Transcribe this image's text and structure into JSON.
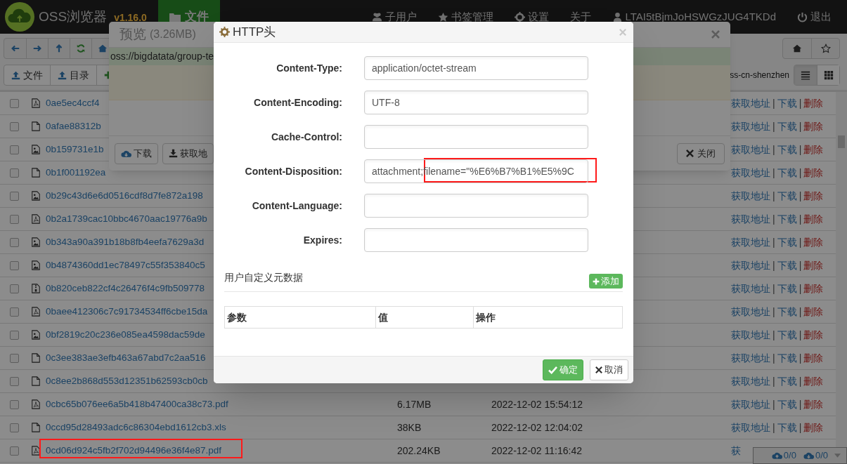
{
  "navbar": {
    "app_name": "OSS浏览器",
    "version": "v1.16.0",
    "tabs": [
      {
        "label": "文件",
        "selected": true
      }
    ],
    "menu": [
      {
        "label": "子用户",
        "kind": "users"
      },
      {
        "label": "书签管理",
        "kind": "star"
      },
      {
        "label": "设置",
        "kind": "gear"
      },
      {
        "label": "关于",
        "kind": "plain"
      },
      {
        "label": "LTAI5tBjmJoHSWGzJUG4TKDd",
        "kind": "user"
      },
      {
        "label": "退出",
        "kind": "power"
      }
    ]
  },
  "toolbar": {
    "upload_buttons": [
      {
        "label": "文件"
      },
      {
        "label": "目录"
      }
    ],
    "region": "ss-cn-shenzhen",
    "view_modes": [
      {
        "kind": "list",
        "selected": true
      },
      {
        "kind": "grid",
        "selected": false
      }
    ]
  },
  "files": [
    {
      "kind": "pdf",
      "name": "0ae5ec4ccf4",
      "checked": false,
      "highlighted": false,
      "actions": [
        {
          "kind": "link",
          "label": "获取地址"
        },
        {
          "kind": "sep",
          "label": "|"
        },
        {
          "kind": "link",
          "label": "下载"
        },
        {
          "kind": "sep",
          "label": "|"
        },
        {
          "kind": "danger",
          "label": "删除"
        }
      ]
    },
    {
      "kind": "file",
      "name": "0afae88312b",
      "checked": false,
      "highlighted": false,
      "actions": [
        {
          "kind": "link",
          "label": "获取地址"
        },
        {
          "kind": "sep",
          "label": "|"
        },
        {
          "kind": "link",
          "label": "下载"
        },
        {
          "kind": "sep",
          "label": "|"
        },
        {
          "kind": "danger",
          "label": "删除"
        }
      ]
    },
    {
      "kind": "image",
      "name": "0b159731e1b",
      "checked": false,
      "highlighted": false,
      "actions": [
        {
          "kind": "link",
          "label": "获取地址"
        },
        {
          "kind": "sep",
          "label": "|"
        },
        {
          "kind": "link",
          "label": "下载"
        },
        {
          "kind": "sep",
          "label": "|"
        },
        {
          "kind": "danger",
          "label": "删除"
        }
      ]
    },
    {
      "kind": "file",
      "name": "0b1f001192ea",
      "checked": false,
      "highlighted": false,
      "actions": [
        {
          "kind": "link",
          "label": "获取地址"
        },
        {
          "kind": "sep",
          "label": "|"
        },
        {
          "kind": "link",
          "label": "下载"
        },
        {
          "kind": "sep",
          "label": "|"
        },
        {
          "kind": "danger",
          "label": "删除"
        }
      ]
    },
    {
      "kind": "image",
      "name": "0b29c43d6e6d0516cdf8d7fe872a198",
      "checked": false,
      "highlighted": false,
      "actions": [
        {
          "kind": "link",
          "label": "获取地址"
        },
        {
          "kind": "sep",
          "label": "|"
        },
        {
          "kind": "link",
          "label": "下载"
        },
        {
          "kind": "sep",
          "label": "|"
        },
        {
          "kind": "danger",
          "label": "删除"
        }
      ]
    },
    {
      "kind": "pdf",
      "name": "0b2a1739cac10bbc4670aac19776a9b",
      "checked": false,
      "highlighted": false,
      "actions": [
        {
          "kind": "link",
          "label": "获取地址"
        },
        {
          "kind": "sep",
          "label": "|"
        },
        {
          "kind": "link",
          "label": "下载"
        },
        {
          "kind": "sep",
          "label": "|"
        },
        {
          "kind": "danger",
          "label": "删除"
        }
      ]
    },
    {
      "kind": "image",
      "name": "0b343a90a391b18b8fb4eefa7629a3d",
      "checked": false,
      "highlighted": false,
      "actions": [
        {
          "kind": "link",
          "label": "获取地址"
        },
        {
          "kind": "sep",
          "label": "|"
        },
        {
          "kind": "link",
          "label": "下载"
        },
        {
          "kind": "sep",
          "label": "|"
        },
        {
          "kind": "danger",
          "label": "删除"
        }
      ]
    },
    {
      "kind": "image",
      "name": "0b4874360dd1ec78497c55f353840c5",
      "checked": false,
      "highlighted": false,
      "actions": [
        {
          "kind": "link",
          "label": "获取地址"
        },
        {
          "kind": "sep",
          "label": "|"
        },
        {
          "kind": "link",
          "label": "下载"
        },
        {
          "kind": "sep",
          "label": "|"
        },
        {
          "kind": "danger",
          "label": "删除"
        }
      ]
    },
    {
      "kind": "archive",
      "name": "0b820ceb822cf4c26476f4c9fb509778",
      "checked": false,
      "highlighted": false,
      "actions": [
        {
          "kind": "link",
          "label": "获取地址"
        },
        {
          "kind": "sep",
          "label": "|"
        },
        {
          "kind": "link",
          "label": "下载"
        },
        {
          "kind": "sep",
          "label": "|"
        },
        {
          "kind": "danger",
          "label": "删除"
        }
      ]
    },
    {
      "kind": "pdf",
      "name": "0baee412306c7c91734534ff6cbe15da",
      "checked": false,
      "highlighted": false,
      "actions": [
        {
          "kind": "link",
          "label": "获取地址"
        },
        {
          "kind": "sep",
          "label": "|"
        },
        {
          "kind": "link",
          "label": "下载"
        },
        {
          "kind": "sep",
          "label": "|"
        },
        {
          "kind": "danger",
          "label": "删除"
        }
      ]
    },
    {
      "kind": "image",
      "name": "0bf2819c20c236e085ea4598dac59de",
      "checked": false,
      "highlighted": false,
      "actions": [
        {
          "kind": "link",
          "label": "获取地址"
        },
        {
          "kind": "sep",
          "label": "|"
        },
        {
          "kind": "link",
          "label": "下载"
        },
        {
          "kind": "sep",
          "label": "|"
        },
        {
          "kind": "danger",
          "label": "删除"
        }
      ]
    },
    {
      "kind": "file",
      "name": "0c3ee383ae3efb463a67abd7c2aa516",
      "checked": false,
      "highlighted": false,
      "actions": [
        {
          "kind": "link",
          "label": "获取地址"
        },
        {
          "kind": "sep",
          "label": "|"
        },
        {
          "kind": "link",
          "label": "下载"
        },
        {
          "kind": "sep",
          "label": "|"
        },
        {
          "kind": "danger",
          "label": "删除"
        }
      ]
    },
    {
      "kind": "file",
      "name": "0c8ee2b868d553d12351b62593cb0cb",
      "checked": false,
      "highlighted": false,
      "actions": [
        {
          "kind": "link",
          "label": "获取地址"
        },
        {
          "kind": "sep",
          "label": "|"
        },
        {
          "kind": "link",
          "label": "下载"
        },
        {
          "kind": "sep",
          "label": "|"
        },
        {
          "kind": "danger",
          "label": "删除"
        }
      ]
    },
    {
      "kind": "pdf",
      "name": "0cbc65b076ee6a5b418b47400ca38c73.pdf",
      "size": "6.17MB",
      "date": "2022-12-02 15:54:12",
      "checked": false,
      "highlighted": false,
      "actions": [
        {
          "kind": "link",
          "label": "获取地址"
        },
        {
          "kind": "sep",
          "label": "|"
        },
        {
          "kind": "link",
          "label": "下载"
        },
        {
          "kind": "sep",
          "label": "|"
        },
        {
          "kind": "danger",
          "label": "删除"
        }
      ]
    },
    {
      "kind": "file",
      "name": "0ccd95d28493adc6c86304ebd1612cb3.xls",
      "size": "38KB",
      "date": "2022-12-02 12:04:02",
      "checked": false,
      "highlighted": false,
      "actions": [
        {
          "kind": "link",
          "label": "获取地址"
        },
        {
          "kind": "sep",
          "label": "|"
        },
        {
          "kind": "link",
          "label": "下载"
        },
        {
          "kind": "sep",
          "label": "|"
        },
        {
          "kind": "danger",
          "label": "删除"
        }
      ]
    },
    {
      "kind": "pdf",
      "name": "0cd06d924c5fb2f702d94496e36f4e87.pdf",
      "size": "202.24KB",
      "date": "2022-12-02 11:16:42",
      "checked": false,
      "highlighted": true,
      "actions": [
        {
          "kind": "link",
          "label": "获"
        }
      ]
    }
  ],
  "transfers": {
    "upload": "0/0",
    "download": "0/0"
  },
  "preview_modal": {
    "title": "预览",
    "size": "(3.26MB)",
    "path": "oss://bigdatata/group-te",
    "buttons": [
      {
        "label": "下载",
        "kind": "cloud"
      },
      {
        "label": "获取地",
        "kind": "download"
      }
    ],
    "close_button": "关闭"
  },
  "http_modal": {
    "title": "HTTP头",
    "fields": [
      {
        "label": "Content-Type:",
        "value": "application/octet-stream",
        "highlighted": false
      },
      {
        "label": "Content-Encoding:",
        "value": "UTF-8",
        "highlighted": false
      },
      {
        "label": "Cache-Control:",
        "highlighted": false
      },
      {
        "label": "Content-Disposition:",
        "value": "attachment;filename=\"%E6%B7%B1%E5%9C",
        "highlighted": true
      },
      {
        "label": "Content-Language:",
        "highlighted": false
      },
      {
        "label": "Expires:",
        "highlighted": false
      }
    ],
    "section_title": "用户自定义元数据",
    "add_button": "添加",
    "table": {
      "columns": [
        "参数",
        "值",
        "操作"
      ]
    },
    "buttons": [
      {
        "label": "确定",
        "kind": "primary"
      },
      {
        "label": "取消",
        "kind": "default"
      }
    ]
  }
}
